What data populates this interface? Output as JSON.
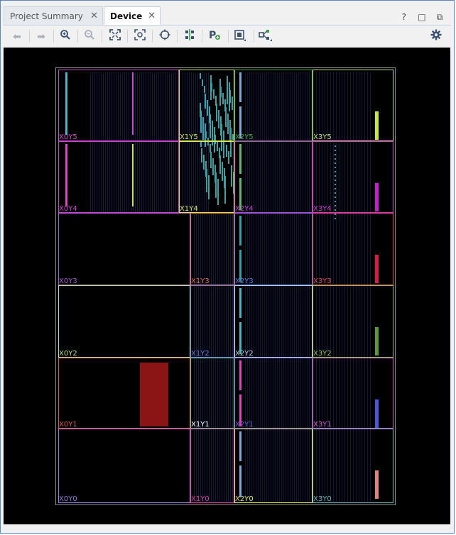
{
  "tabs": [
    {
      "label": "Project Summary",
      "active": false
    },
    {
      "label": "Device",
      "active": true
    }
  ],
  "window_controls": {
    "help": "?",
    "restore": "□",
    "float": "⧉"
  },
  "toolbar": {
    "icons": [
      "back-icon",
      "forward-icon",
      "zoom-in-icon",
      "zoom-out-icon",
      "zoom-fit-icon",
      "zoom-to-selected-icon",
      "auto-fit-selection-icon",
      "routing-resources-icon",
      "add-pblock-icon",
      "show-clock-regions-icon",
      "view-options-icon",
      "settings-icon"
    ]
  },
  "device": {
    "regions": [
      {
        "name": "X0Y5",
        "label_color": "#d24fd0",
        "border_color": "#c34bd0"
      },
      {
        "name": "X1Y5",
        "label_color": "#c9e35a",
        "border_color": "#c9e35a"
      },
      {
        "name": "X2Y5",
        "label_color": "#37a845",
        "border_color": "#37a845"
      },
      {
        "name": "X3Y5",
        "label_color": "#bfdf7a",
        "border_color": "#bfdf7a"
      },
      {
        "name": "X0Y4",
        "label_color": "#d33fd2",
        "border_color": "#d33fd2"
      },
      {
        "name": "X1Y4",
        "label_color": "#d9e64f",
        "border_color": "#d9e64f"
      },
      {
        "name": "X2Y4",
        "label_color": "#cc3ad0",
        "border_color": "#cc3ad0"
      },
      {
        "name": "X3Y4",
        "label_color": "#d23bd1",
        "border_color": "#d23bd1"
      },
      {
        "name": "X0Y3",
        "label_color": "#a85cd1",
        "border_color": "#a85cd1"
      },
      {
        "name": "X1Y3",
        "label_color": "#e1704a",
        "border_color": "#e1704a"
      },
      {
        "name": "X2Y3",
        "label_color": "#5b79e0",
        "border_color": "#5b79e0"
      },
      {
        "name": "X3Y3",
        "label_color": "#e2455e",
        "border_color": "#e2455e"
      },
      {
        "name": "X0Y2",
        "label_color": "#b9e27a",
        "border_color": "#b9e27a"
      },
      {
        "name": "X1Y2",
        "label_color": "#6a7ad8",
        "border_color": "#6a7ad8"
      },
      {
        "name": "X2Y2",
        "label_color": "#b8d0e0",
        "border_color": "#b8d0e0"
      },
      {
        "name": "X3Y2",
        "label_color": "#8cc15a",
        "border_color": "#8cc15a"
      },
      {
        "name": "X0Y1",
        "label_color": "#e05454",
        "border_color": "#e05454"
      },
      {
        "name": "X1Y1",
        "label_color": "#ffffff",
        "border_color": "#5ecb86"
      },
      {
        "name": "X2Y1",
        "label_color": "#6e5ed8",
        "border_color": "#6e5ed8"
      },
      {
        "name": "X3Y1",
        "label_color": "#d558c8",
        "border_color": "#d558c8"
      },
      {
        "name": "X0Y0",
        "label_color": "#9a7ae0",
        "border_color": "#9a7ae0"
      },
      {
        "name": "X1Y0",
        "label_color": "#de3fa0",
        "border_color": "#de3fa0"
      },
      {
        "name": "X2Y0",
        "label_color": "#e6e64a",
        "border_color": "#e6e64a"
      },
      {
        "name": "X3Y0",
        "label_color": "#58b8b8",
        "border_color": "#58b8b8"
      }
    ],
    "pblock_color": "#8b1414",
    "bram_colors": [
      "#c8e640",
      "#c61cd2",
      "#e0184a",
      "#5a9a34",
      "#4a56e0",
      "#e08478"
    ],
    "clock_column_colors": [
      "#46b6c8",
      "#e040c8",
      "#7aa8e0",
      "#5ab878",
      "#30a0b0"
    ]
  }
}
